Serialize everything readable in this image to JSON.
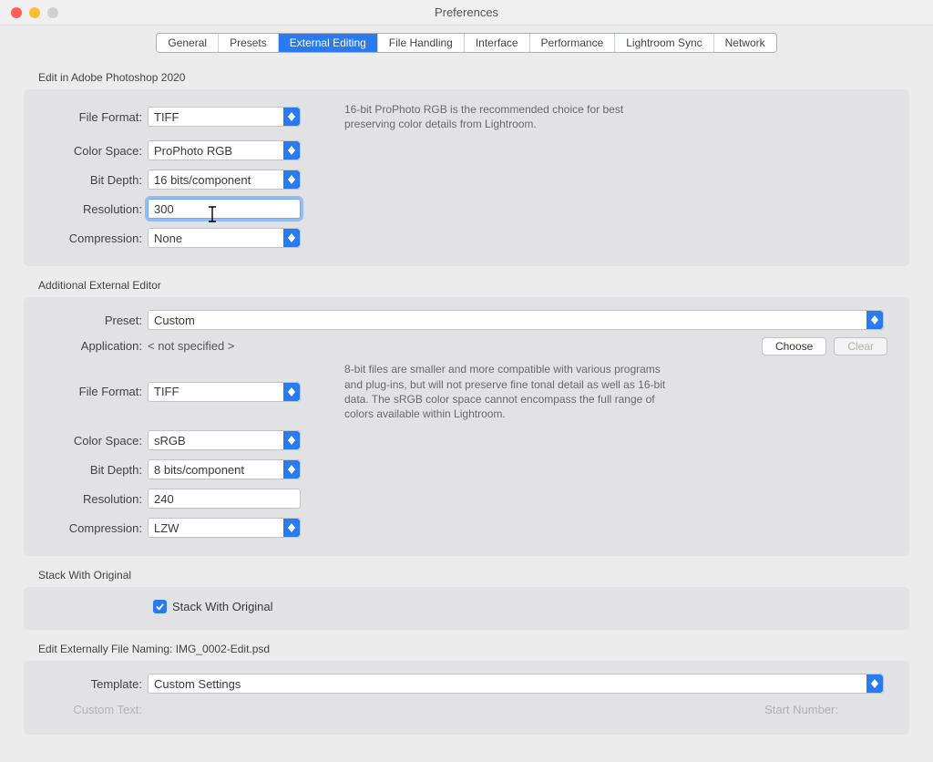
{
  "window": {
    "title": "Preferences"
  },
  "tabs": [
    "General",
    "Presets",
    "External Editing",
    "File Handling",
    "Interface",
    "Performance",
    "Lightroom Sync",
    "Network"
  ],
  "selected_tab": "External Editing",
  "section1": {
    "header": "Edit in Adobe Photoshop 2020",
    "file_format_label": "File Format:",
    "file_format": "TIFF",
    "color_space_label": "Color Space:",
    "color_space": "ProPhoto RGB",
    "bit_depth_label": "Bit Depth:",
    "bit_depth": "16 bits/component",
    "resolution_label": "Resolution:",
    "resolution": "300",
    "compression_label": "Compression:",
    "compression": "None",
    "help": "16-bit ProPhoto RGB is the recommended choice for best preserving color details from Lightroom."
  },
  "section2": {
    "header": "Additional External Editor",
    "preset_label": "Preset:",
    "preset": "Custom",
    "application_label": "Application:",
    "application": "< not specified >",
    "choose": "Choose",
    "clear": "Clear",
    "file_format_label": "File Format:",
    "file_format": "TIFF",
    "color_space_label": "Color Space:",
    "color_space": "sRGB",
    "bit_depth_label": "Bit Depth:",
    "bit_depth": "8 bits/component",
    "resolution_label": "Resolution:",
    "resolution": "240",
    "compression_label": "Compression:",
    "compression": "LZW",
    "help": "8-bit files are smaller and more compatible with various programs and plug-ins, but will not preserve fine tonal detail as well as 16-bit data. The sRGB color space cannot encompass the full range of colors available within Lightroom."
  },
  "section3": {
    "header": "Stack With Original",
    "checkbox_label": "Stack With Original",
    "checked": true
  },
  "section4": {
    "header": "Edit Externally File Naming:  IMG_0002-Edit.psd",
    "template_label": "Template:",
    "template": "Custom Settings",
    "custom_text_label": "Custom Text:",
    "start_number_label": "Start Number:"
  }
}
